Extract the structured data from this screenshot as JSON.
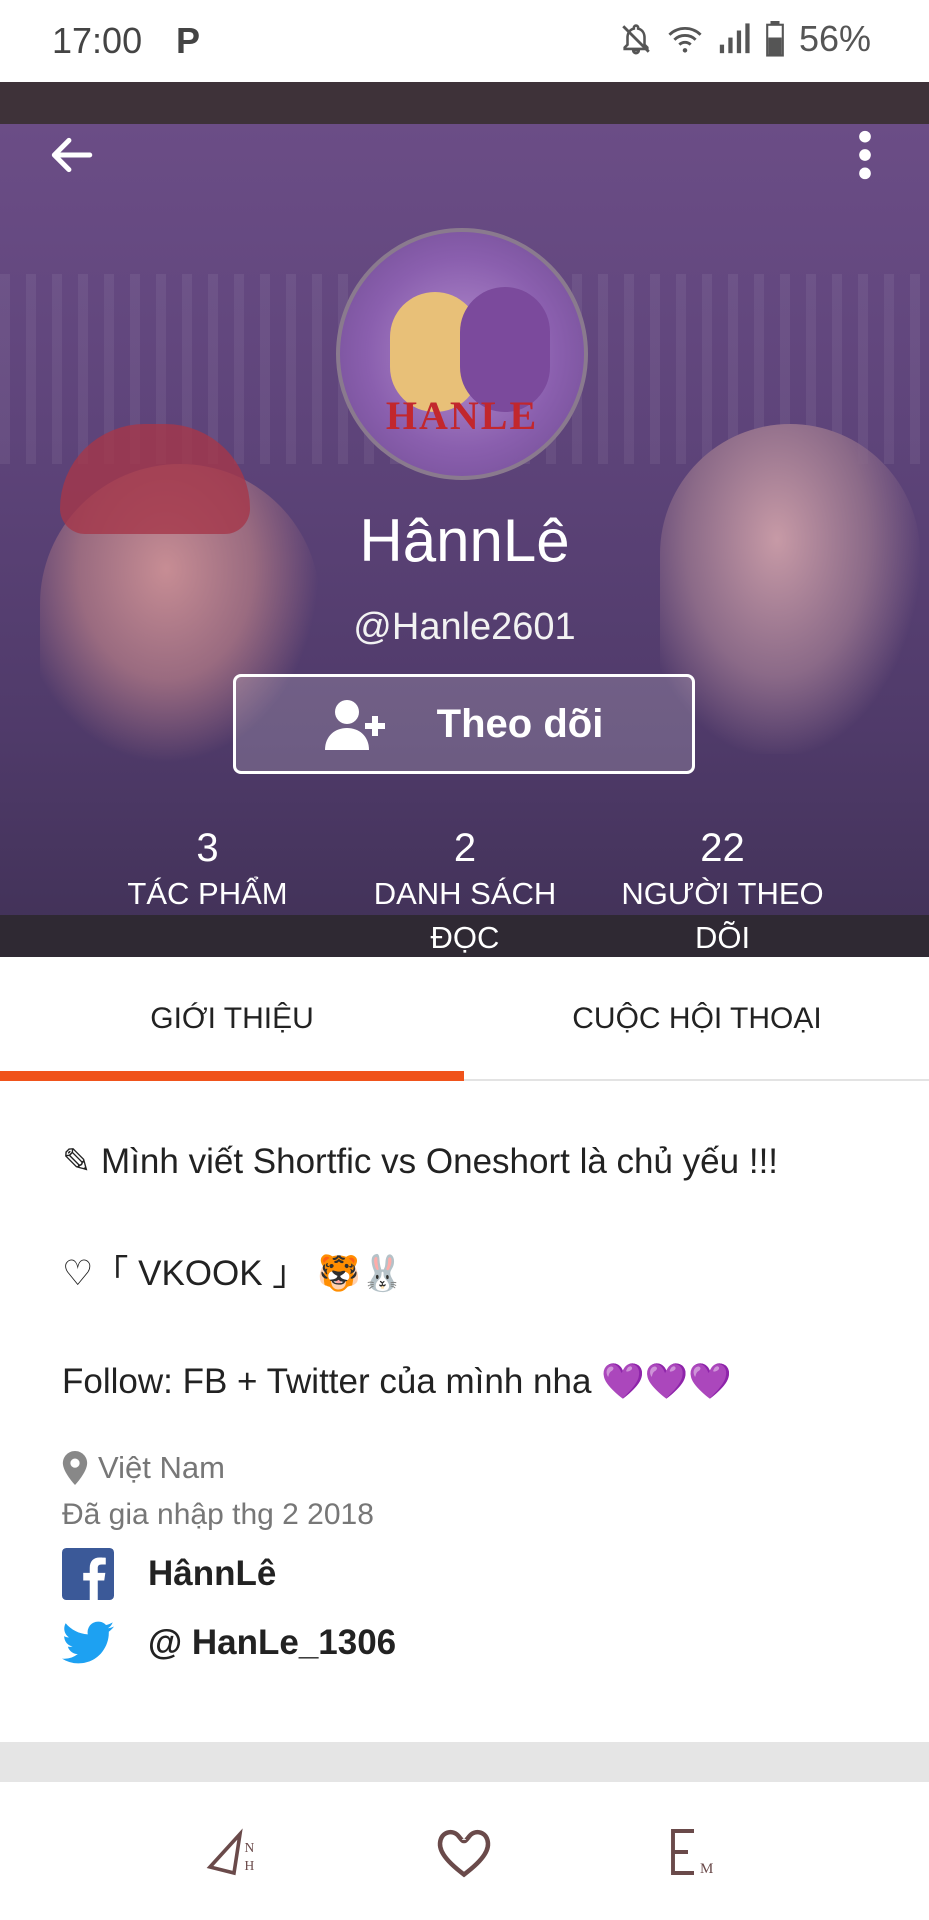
{
  "status_bar": {
    "time": "17:00",
    "app_indicator": "P",
    "battery": "56%",
    "icons": [
      "bell-off-icon",
      "wifi-icon",
      "signal-icon",
      "battery-icon"
    ]
  },
  "header": {
    "display_name": "HânnLê",
    "username": "@Hanle2601",
    "avatar_text": "HANLE",
    "follow_label": "Theo dõi",
    "stats": [
      {
        "value": "3",
        "label": "TÁC PHẨM"
      },
      {
        "value": "2",
        "label": "DANH SÁCH ĐỌC"
      },
      {
        "value": "22",
        "label": "NGƯỜI THEO DÕI"
      }
    ]
  },
  "tabs": [
    {
      "label": "GIỚI THIỆU",
      "active": true
    },
    {
      "label": "CUỘC HỘI THOẠI",
      "active": false
    }
  ],
  "about": {
    "bio_lines": [
      "✎ Mình viết Shortfic vs Oneshort là chủ yếu !!!",
      "♡「 VKOOK 」 🐯🐰",
      "Follow: FB + Twitter của mình nha 💜💜💜"
    ],
    "location": "Việt Nam",
    "joined": "Đã gia nhập thg 2 2018",
    "facebook": "HânnLê",
    "twitter": "@ HanLe_1306"
  },
  "colors": {
    "accent": "#f0531b",
    "header_bg": "#5e447a",
    "facebook": "#3b5998",
    "twitter": "#1da1f2"
  },
  "bottom_bar": {
    "icons": [
      "anh-logo-icon",
      "heart-icon",
      "em-logo-icon"
    ]
  }
}
